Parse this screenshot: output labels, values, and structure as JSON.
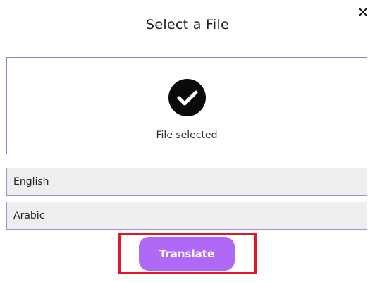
{
  "dialog": {
    "title": "Select a File",
    "close_icon": "close-icon"
  },
  "dropzone": {
    "status_icon": "check-circle-icon",
    "status_text": "File selected"
  },
  "languages": {
    "source": "English",
    "target": "Arabic"
  },
  "actions": {
    "translate_label": "Translate"
  },
  "colors": {
    "accent": "#b068f7",
    "border": "#8a86c4",
    "field_bg": "#eeeeee",
    "highlight": "#e0162b",
    "check_bg": "#0a0a0a"
  }
}
